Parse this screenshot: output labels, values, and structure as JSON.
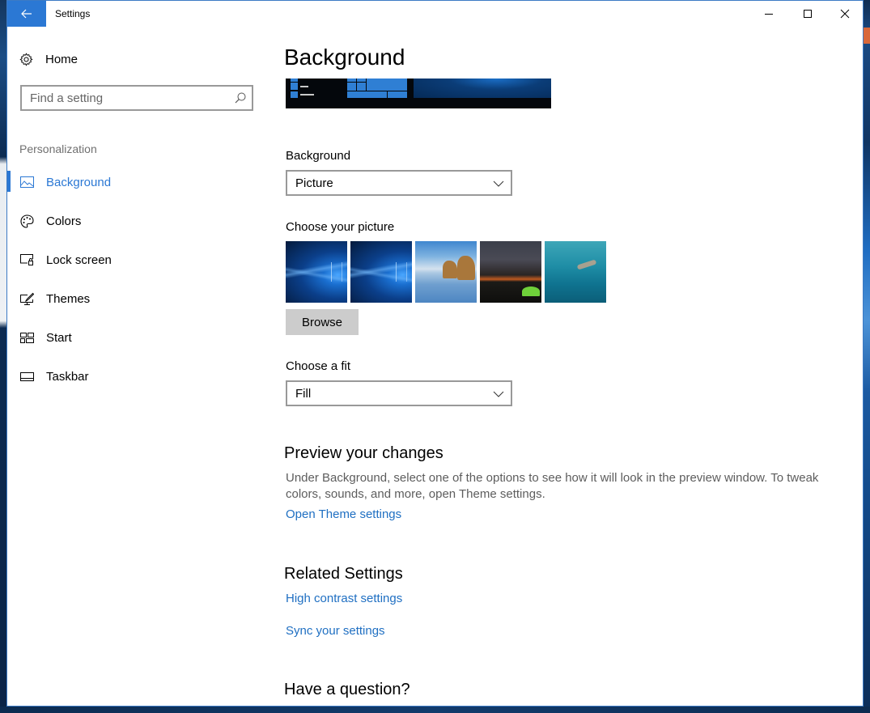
{
  "window": {
    "title": "Settings",
    "back_icon": "arrow-left-icon",
    "controls": {
      "minimize_icon": "minimize-icon",
      "maximize_icon": "maximize-icon",
      "close_icon": "close-icon"
    }
  },
  "sidebar": {
    "home": {
      "label": "Home",
      "icon": "gear-icon"
    },
    "search": {
      "placeholder": "Find a setting",
      "value": "",
      "icon": "search-icon"
    },
    "section_label": "Personalization",
    "items": [
      {
        "label": "Background",
        "icon": "picture-icon",
        "active": true
      },
      {
        "label": "Colors",
        "icon": "palette-icon",
        "active": false
      },
      {
        "label": "Lock screen",
        "icon": "lock-screen-icon",
        "active": false
      },
      {
        "label": "Themes",
        "icon": "themes-icon",
        "active": false
      },
      {
        "label": "Start",
        "icon": "start-icon",
        "active": false
      },
      {
        "label": "Taskbar",
        "icon": "taskbar-icon",
        "active": false
      }
    ]
  },
  "main": {
    "title": "Background",
    "background_field": {
      "label": "Background",
      "value": "Picture"
    },
    "picture_field": {
      "label": "Choose your picture",
      "pictures": [
        {
          "name": "Windows 10 hero (blue)"
        },
        {
          "name": "Windows 10 hero (blue)"
        },
        {
          "name": "Beach with rocks"
        },
        {
          "name": "Night sky with tent"
        },
        {
          "name": "Underwater swimmer"
        }
      ],
      "browse_label": "Browse"
    },
    "fit_field": {
      "label": "Choose a fit",
      "value": "Fill"
    },
    "preview_section": {
      "title": "Preview your changes",
      "description": "Under Background, select one of the options to see how it will look in the preview window. To tweak colors, sounds, and more, open Theme settings.",
      "link": "Open Theme settings"
    },
    "related_section": {
      "title": "Related Settings",
      "links": [
        "High contrast settings",
        "Sync your settings"
      ]
    },
    "question_section": {
      "title": "Have a question?"
    }
  },
  "colors": {
    "accent": "#2b78d4",
    "link": "#1f6fc2",
    "secondary_text": "#5d5d5d",
    "section_label": "#707070",
    "button_bg": "#cccccc"
  }
}
